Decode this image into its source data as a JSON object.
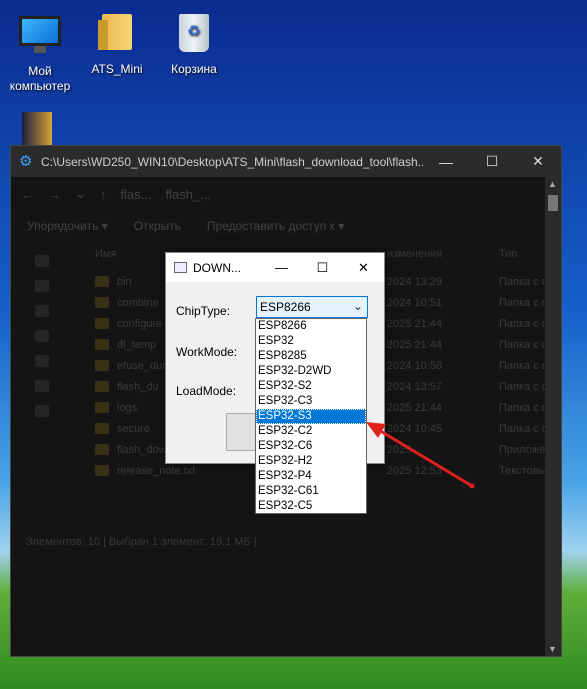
{
  "desktop": {
    "icons": [
      {
        "label": "Мой компьютер",
        "icon": "computer-icon"
      },
      {
        "label": "ATS_Mini",
        "icon": "folder-icon"
      },
      {
        "label": "Корзина",
        "icon": "recycle-bin-icon"
      }
    ]
  },
  "explorer": {
    "title": "C:\\Users\\WD250_WIN10\\Desktop\\ATS_Mini\\flash_download_tool\\flash...",
    "path_segments": [
      "flas...",
      "flash_..."
    ],
    "toolbar": {
      "organize": "Упорядочить ▾",
      "open": "Открыть",
      "share": "Предоставить доступ к ▾"
    },
    "columns": {
      "name": "Имя",
      "date": "изменения",
      "type": "Тип"
    },
    "rows": [
      {
        "name": "bin",
        "date": "2024 13:29",
        "type": "Папка с фа"
      },
      {
        "name": "combine",
        "date": "2024 10:51",
        "type": "Папка с фа"
      },
      {
        "name": "configure",
        "date": "2025 21:44",
        "type": "Папка с фа"
      },
      {
        "name": "dl_temp",
        "date": "2025 21:44",
        "type": "Папка с фа"
      },
      {
        "name": "efuse_dum",
        "date": "2024 10:58",
        "type": "Папка с фа"
      },
      {
        "name": "flash_du",
        "date": "2024 13:57",
        "type": "Папка с фа"
      },
      {
        "name": "logs",
        "date": "2025 21:44",
        "type": "Папка с фа"
      },
      {
        "name": "secure",
        "date": "2024 10:45",
        "type": "Папка с фа"
      },
      {
        "name": "flash_dow",
        "date": "2025",
        "type": "Приложен"
      },
      {
        "name": "release_note.txt",
        "date": "2025 12:53",
        "type": "Текстовы"
      }
    ],
    "status": "Элементов: 10   |   Выбран 1 элемент: 19,1 МБ   |"
  },
  "dialog": {
    "title": "DOWN...",
    "chip_label": "ChipType:",
    "work_label": "WorkMode:",
    "load_label": "LoadMode:",
    "chip_value": "ESP8266",
    "options": [
      "ESP8266",
      "ESP32",
      "ESP8285",
      "ESP32-D2WD",
      "ESP32-S2",
      "ESP32-C3",
      "ESP32-S3",
      "ESP32-C2",
      "ESP32-C6",
      "ESP32-H2",
      "ESP32-P4",
      "ESP32-C61",
      "ESP32-C5"
    ],
    "highlighted_option": "ESP32-S3"
  },
  "colors": {
    "selection": "#0078d7",
    "annotation_arrow": "#e0201c"
  }
}
